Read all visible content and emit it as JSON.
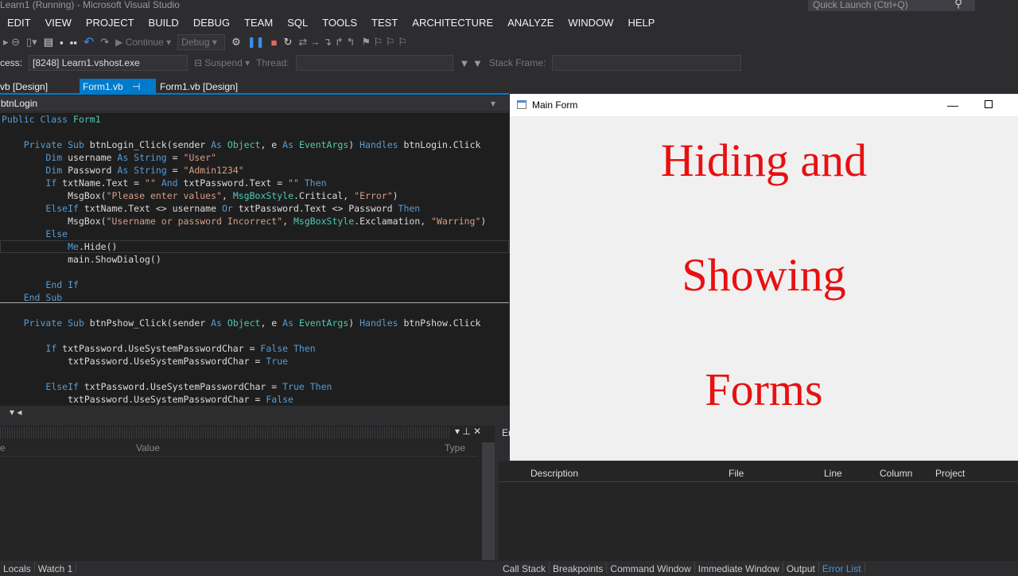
{
  "window_title": "Learn1 (Running) - Microsoft Visual Studio",
  "quick_launch": "Quick Launch (Ctrl+Q)",
  "menu": [
    "EDIT",
    "VIEW",
    "PROJECT",
    "BUILD",
    "DEBUG",
    "TEAM",
    "SQL",
    "TOOLS",
    "TEST",
    "ARCHITECTURE",
    "ANALYZE",
    "WINDOW",
    "HELP"
  ],
  "toolbar": {
    "continue": "Continue",
    "config": "Debug",
    "process_label": "cess:",
    "process": "[8248] Learn1.vshost.exe",
    "suspend": "Suspend",
    "thread": "Thread:",
    "stack_frame": "Stack Frame:"
  },
  "tabs": [
    "vb [Design]",
    "Form1.vb",
    "Form1.vb [Design]"
  ],
  "nav_member": "btnLogin",
  "code": [
    [
      [
        "k",
        "Public Class "
      ],
      [
        "t",
        "Form1"
      ]
    ],
    [],
    [
      [
        "p",
        "    "
      ],
      [
        "k",
        "Private Sub "
      ],
      [
        "p",
        "btnLogin_Click(sender "
      ],
      [
        "k",
        "As "
      ],
      [
        "t",
        "Object"
      ],
      [
        "p",
        ", e "
      ],
      [
        "k",
        "As "
      ],
      [
        "t",
        "EventArgs"
      ],
      [
        "p",
        ") "
      ],
      [
        "k",
        "Handles "
      ],
      [
        "p",
        "btnLogin.Click"
      ]
    ],
    [
      [
        "p",
        "        "
      ],
      [
        "k",
        "Dim "
      ],
      [
        "p",
        "username "
      ],
      [
        "k",
        "As String "
      ],
      [
        "p",
        "= "
      ],
      [
        "s",
        "\"User\""
      ]
    ],
    [
      [
        "p",
        "        "
      ],
      [
        "k",
        "Dim "
      ],
      [
        "p",
        "Password "
      ],
      [
        "k",
        "As String "
      ],
      [
        "p",
        "= "
      ],
      [
        "s",
        "\"Admin1234\""
      ]
    ],
    [
      [
        "p",
        "        "
      ],
      [
        "k",
        "If "
      ],
      [
        "p",
        "txtName.Text = "
      ],
      [
        "s",
        "\"\" "
      ],
      [
        "k",
        "And "
      ],
      [
        "p",
        "txtPassword.Text = "
      ],
      [
        "s",
        "\"\" "
      ],
      [
        "k",
        "Then"
      ]
    ],
    [
      [
        "p",
        "            MsgBox("
      ],
      [
        "s",
        "\"Please enter values\""
      ],
      [
        "p",
        ", "
      ],
      [
        "t",
        "MsgBoxStyle"
      ],
      [
        "p",
        ".Critical, "
      ],
      [
        "s",
        "\"Error\""
      ],
      [
        "p",
        ")"
      ]
    ],
    [
      [
        "p",
        "        "
      ],
      [
        "k",
        "ElseIf "
      ],
      [
        "p",
        "txtName.Text <> username "
      ],
      [
        "k",
        "Or "
      ],
      [
        "p",
        "txtPassword.Text <> Password "
      ],
      [
        "k",
        "Then"
      ]
    ],
    [
      [
        "p",
        "            MsgBox("
      ],
      [
        "s",
        "\"Username or password Incorrect\""
      ],
      [
        "p",
        ", "
      ],
      [
        "t",
        "MsgBoxStyle"
      ],
      [
        "p",
        ".Exclamation, "
      ],
      [
        "s",
        "\"Warring\""
      ],
      [
        "p",
        ")"
      ]
    ],
    [
      [
        "p",
        "        "
      ],
      [
        "k",
        "Else"
      ]
    ],
    [
      [
        "p",
        "            "
      ],
      [
        "k",
        "Me"
      ],
      [
        "p",
        ".Hide()"
      ]
    ],
    [
      [
        "p",
        "            main.ShowDialog()"
      ]
    ],
    [],
    [
      [
        "p",
        "        "
      ],
      [
        "k",
        "End If"
      ]
    ],
    [
      [
        "p",
        "    "
      ],
      [
        "k",
        "End Sub"
      ]
    ],
    [],
    [
      [
        "p",
        "    "
      ],
      [
        "k",
        "Private Sub "
      ],
      [
        "p",
        "btnPshow_Click(sender "
      ],
      [
        "k",
        "As "
      ],
      [
        "t",
        "Object"
      ],
      [
        "p",
        ", e "
      ],
      [
        "k",
        "As "
      ],
      [
        "t",
        "EventArgs"
      ],
      [
        "p",
        ") "
      ],
      [
        "k",
        "Handles "
      ],
      [
        "p",
        "btnPshow.Click"
      ]
    ],
    [],
    [
      [
        "p",
        "        "
      ],
      [
        "k",
        "If "
      ],
      [
        "p",
        "txtPassword.UseSystemPasswordChar = "
      ],
      [
        "k",
        "False Then"
      ]
    ],
    [
      [
        "p",
        "            txtPassword.UseSystemPasswordChar = "
      ],
      [
        "k",
        "True"
      ]
    ],
    [],
    [
      [
        "p",
        "        "
      ],
      [
        "k",
        "ElseIf "
      ],
      [
        "p",
        "txtPassword.UseSystemPasswordChar = "
      ],
      [
        "k",
        "True Then"
      ]
    ],
    [
      [
        "p",
        "            txtPassword.UseSystemPasswordChar = "
      ],
      [
        "k",
        "False"
      ]
    ]
  ],
  "locals": {
    "cols": [
      "me",
      "Value",
      "Type"
    ],
    "tabs": [
      "Locals",
      "Watch 1"
    ]
  },
  "errors": {
    "title": "Er",
    "cols": [
      "Description",
      "File",
      "Line",
      "Column",
      "Project"
    ]
  },
  "bottom_tabs": [
    "Call Stack",
    "Breakpoints",
    "Command Window",
    "Immediate Window",
    "Output",
    "Error List"
  ],
  "main_form": {
    "title": "Main Form",
    "lines": [
      "Hiding and",
      "Showing",
      "Forms"
    ]
  }
}
